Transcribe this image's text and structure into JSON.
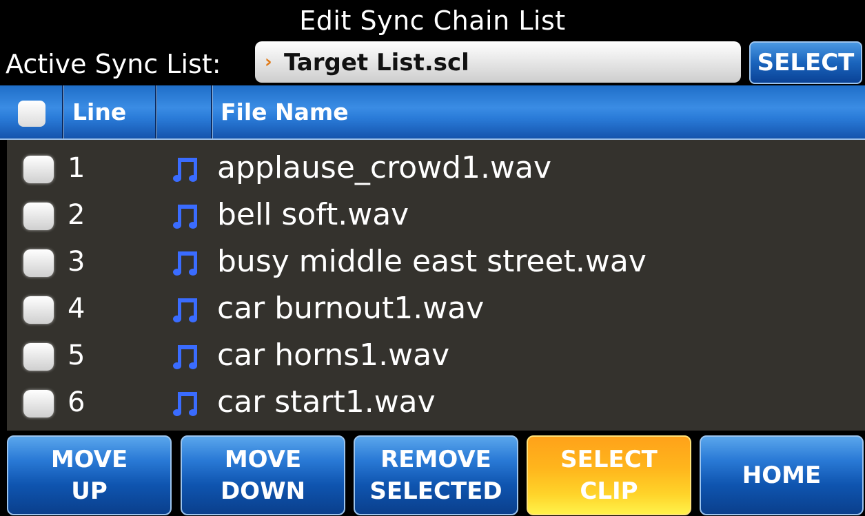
{
  "title": "Edit Sync Chain List",
  "active_sync": {
    "label": "Active Sync List:",
    "value": "Target List.scl",
    "chevron": "›",
    "select_label": "SELECT"
  },
  "table": {
    "header": {
      "line": "Line",
      "file_name": "File Name"
    },
    "rows": [
      {
        "line": "1",
        "file": "applause_crowd1.wav",
        "icon": "music-note-icon"
      },
      {
        "line": "2",
        "file": "bell soft.wav",
        "icon": "music-note-icon"
      },
      {
        "line": "3",
        "file": "busy middle east street.wav",
        "icon": "music-note-icon"
      },
      {
        "line": "4",
        "file": "car burnout1.wav",
        "icon": "music-note-icon"
      },
      {
        "line": "5",
        "file": "car horns1.wav",
        "icon": "music-note-icon"
      },
      {
        "line": "6",
        "file": "car start1.wav",
        "icon": "music-note-icon"
      }
    ]
  },
  "buttons": {
    "move_up": [
      "MOVE",
      "UP"
    ],
    "move_down": [
      "MOVE",
      "DOWN"
    ],
    "remove_selected": [
      "REMOVE",
      "SELECTED"
    ],
    "select_clip": [
      "SELECT",
      "CLIP"
    ],
    "home": "HOME"
  },
  "colors": {
    "accent_blue": "#1f6ec8",
    "highlight_orange": "#ffb51c",
    "list_bg": "#34322d",
    "chevron": "#e07a18",
    "note_icon": "#3a6cff"
  }
}
